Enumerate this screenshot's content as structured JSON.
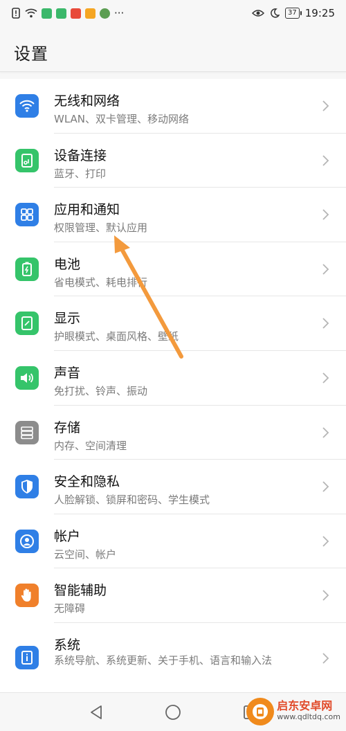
{
  "status_bar": {
    "time": "19:25",
    "battery": "37",
    "overflow": "···",
    "badge_colors": [
      "#3bb86b",
      "#3bb86b",
      "#e84a3a",
      "#f5a623",
      "#5c9e52"
    ]
  },
  "header": {
    "title": "设置"
  },
  "settings": [
    {
      "title": "无线和网络",
      "subtitle": "WLAN、双卡管理、移动网络",
      "icon": "wifi-icon",
      "color": "#2f7fe6"
    },
    {
      "title": "设备连接",
      "subtitle": "蓝牙、打印",
      "icon": "device-connection-icon",
      "color": "#35c46a"
    },
    {
      "title": "应用和通知",
      "subtitle": "权限管理、默认应用",
      "icon": "apps-grid-icon",
      "color": "#2f7fe6"
    },
    {
      "title": "电池",
      "subtitle": "省电模式、耗电排行",
      "icon": "battery-icon",
      "color": "#35c46a"
    },
    {
      "title": "显示",
      "subtitle": "护眼模式、桌面风格、壁纸",
      "icon": "display-icon",
      "color": "#35c46a"
    },
    {
      "title": "声音",
      "subtitle": "免打扰、铃声、振动",
      "icon": "speaker-icon",
      "color": "#35c46a"
    },
    {
      "title": "存储",
      "subtitle": "内存、空间清理",
      "icon": "storage-icon",
      "color": "#8c8c8c"
    },
    {
      "title": "安全和隐私",
      "subtitle": "人脸解锁、锁屏和密码、学生模式",
      "icon": "shield-icon",
      "color": "#2f7fe6"
    },
    {
      "title": "帐户",
      "subtitle": "云空间、帐户",
      "icon": "account-icon",
      "color": "#2f7fe6"
    },
    {
      "title": "智能辅助",
      "subtitle": "无障碍",
      "icon": "hand-icon",
      "color": "#f0802b"
    },
    {
      "title": "系统",
      "subtitle": "系统导航、系统更新、关于手机、语言和输入法",
      "icon": "system-info-icon",
      "color": "#2f7fe6"
    }
  ],
  "nav": {
    "back": "back-icon",
    "home": "home-icon",
    "recents": "recents-icon"
  },
  "watermark": {
    "name": "启东安卓网",
    "url": "www.qdltdq.com"
  },
  "annotation": {
    "color": "#f39a3d"
  }
}
